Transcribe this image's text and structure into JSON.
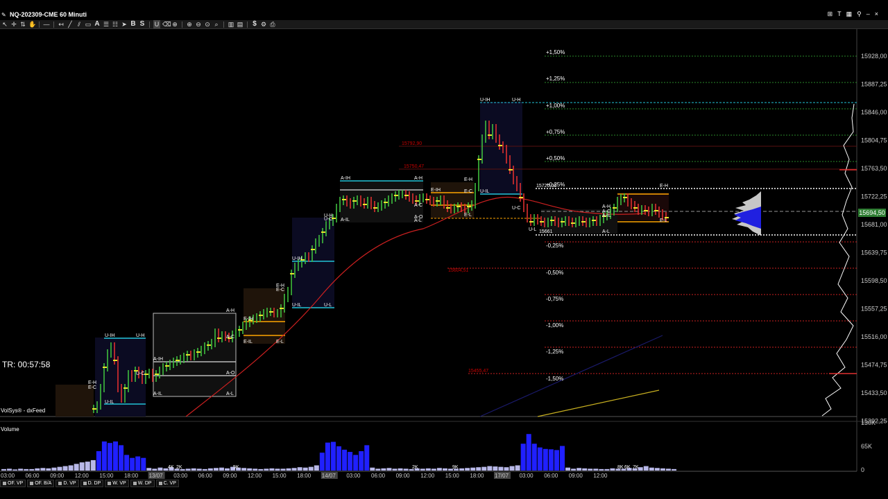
{
  "window": {
    "symbol": "NQ-202309-CME",
    "timeframe": "60 Minuti"
  },
  "toolbar_icons": [
    "cursor-icon",
    "crosshair-icon",
    "move-icon",
    "hand-icon",
    "line-icon",
    "ray-icon",
    "trendline-icon",
    "channel-icon",
    "rectangle-icon",
    "text-icon",
    "fibonacci-icon",
    "pitchfork-icon",
    "arrow-icon",
    "bid-icon",
    "sell-icon",
    "magnet-icon",
    "eraser-icon",
    "lock-icon",
    "zoom-in-icon",
    "zoom-out-icon",
    "zoom-reset-icon",
    "search-icon",
    "bar-chart-icon",
    "chart-type-icon",
    "dollar-icon",
    "settings-icon",
    "pin-icon"
  ],
  "toolbar_text": {
    "a": "A",
    "b": "B",
    "s": "S",
    "dollar": "$"
  },
  "window_controls": {
    "t": "T"
  },
  "price_axis": {
    "labels": [
      "15928,00",
      "15887,25",
      "15846,00",
      "15804,75",
      "15763,50",
      "15722,25",
      "15681,00",
      "15639,75",
      "15598,50",
      "15557,25",
      "15516,00",
      "15474,75",
      "15433,50",
      "15392,25"
    ],
    "current": "15694,50"
  },
  "percent_levels": [
    "+1,50%",
    "+1,25%",
    "+1,00%",
    "+0,75%",
    "+0,50%",
    "+0,25%",
    "-0,25%",
    "-0,50%",
    "-0,75%",
    "-1,00%",
    "-1,25%",
    "-1,50%"
  ],
  "level_labels": {
    "l1": "15792,90",
    "l2": "15750,47",
    "l3": "15720,00",
    "l4": "15604,51",
    "l5": "15455,47",
    "l6": "15661"
  },
  "ib_labels": {
    "day1": [
      "U-IH",
      "U-H",
      "U-C",
      "U-IL",
      "E-H",
      "E-C",
      "E-L"
    ],
    "day2": [
      "A-IH",
      "A-H",
      "A-C",
      "A-O",
      "A-IL",
      "A-L",
      "E-IH",
      "E-H",
      "E-C",
      "E-IL",
      "E-L"
    ],
    "day3": [
      "U-IH",
      "U-H",
      "U-C",
      "U-IL",
      "U-L"
    ],
    "day4": [
      "A-IH",
      "A-H",
      "A-C",
      "A-O",
      "A-IL",
      "A-L",
      "E-IH",
      "E-H",
      "E-C",
      "E-L"
    ],
    "day5": [
      "U-IH",
      "U-H",
      "U-IL",
      "U-C",
      "U-L",
      "A-H",
      "A-C",
      "A-IL",
      "A-L",
      "E-H",
      "E-L"
    ]
  },
  "tr": "TR: 00:57:58",
  "feed": "VolSys® - dxFeed",
  "volume": {
    "title": "Volume",
    "axis": [
      "130K",
      "65K",
      "0"
    ],
    "values": [
      4,
      5,
      3,
      5,
      4,
      4,
      6,
      7,
      6,
      8,
      10,
      12,
      14,
      18,
      22,
      24,
      28,
      52,
      78,
      74,
      78,
      68,
      42,
      34,
      38,
      34,
      7,
      5,
      8,
      6,
      9,
      5,
      4,
      5,
      6,
      5,
      4,
      6,
      7,
      8,
      6,
      10,
      8,
      7,
      6,
      5,
      4,
      5,
      6,
      5,
      5,
      6,
      7,
      9,
      8,
      10,
      14,
      48,
      75,
      77,
      65,
      56,
      50,
      42,
      52,
      68,
      8,
      5,
      6,
      7,
      5,
      6,
      5,
      4,
      6,
      5,
      6,
      5,
      7,
      6,
      5,
      5,
      6,
      7,
      8,
      9,
      10,
      12,
      11,
      10,
      9,
      12,
      14,
      72,
      98,
      72,
      62,
      58,
      57,
      55,
      66,
      8,
      5,
      7,
      6,
      5,
      5,
      4,
      4,
      6,
      5,
      5,
      7,
      6,
      9,
      12,
      8,
      7,
      6,
      5,
      4
    ],
    "bar_labels": [
      "4K",
      "2K",
      "5K",
      "2K",
      "9K",
      "8K",
      "6K",
      "7K"
    ]
  },
  "time_axis": [
    "03:00",
    "06:00",
    "09:00",
    "12:00",
    "15:00",
    "18:00",
    "13/07",
    "03:00",
    "06:00",
    "09:00",
    "12:00",
    "15:00",
    "18:00",
    "14/07",
    "03:00",
    "06:00",
    "09:00",
    "12:00",
    "15:00",
    "18:00",
    "17/07",
    "03:00",
    "06:00",
    "09:00",
    "12:00"
  ],
  "tabs": [
    "OF. VP",
    "OF. B/A",
    "D. VP",
    "D. DP",
    "W. VP",
    "W. DP",
    "C. VP"
  ],
  "colors": {
    "up": "#3fbf3f",
    "down": "#e03030",
    "ib": "#22c4d8",
    "vol": "#2020ff",
    "vwap": "#cc2020"
  }
}
